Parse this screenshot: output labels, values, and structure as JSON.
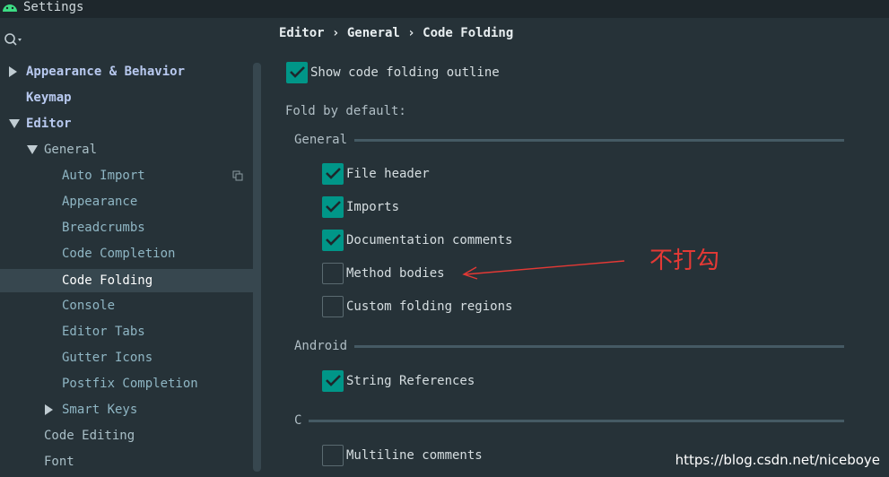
{
  "window": {
    "title": "Settings"
  },
  "sidebar": {
    "items": [
      {
        "label": "Appearance & Behavior",
        "arrow": "right"
      },
      {
        "label": "Keymap"
      },
      {
        "label": "Editor",
        "arrow": "down"
      },
      {
        "label": "General",
        "arrow": "down"
      },
      {
        "label": "Auto Import"
      },
      {
        "label": "Appearance"
      },
      {
        "label": "Breadcrumbs"
      },
      {
        "label": "Code Completion"
      },
      {
        "label": "Code Folding",
        "selected": true
      },
      {
        "label": "Console"
      },
      {
        "label": "Editor Tabs"
      },
      {
        "label": "Gutter Icons"
      },
      {
        "label": "Postfix Completion"
      },
      {
        "label": "Smart Keys",
        "arrow": "right"
      },
      {
        "label": "Code Editing"
      },
      {
        "label": "Font"
      }
    ]
  },
  "main": {
    "breadcrumb": "Editor › General › Code Folding",
    "show_outline": {
      "label": "Show code folding outline",
      "checked": true
    },
    "fold_by_default": "Fold by default:",
    "groups": [
      {
        "title": "General",
        "options": [
          {
            "label": "File header",
            "checked": true
          },
          {
            "label": "Imports",
            "checked": true
          },
          {
            "label": "Documentation comments",
            "checked": true
          },
          {
            "label": "Method bodies",
            "checked": false
          },
          {
            "label": "Custom folding regions",
            "checked": false
          }
        ]
      },
      {
        "title": "Android",
        "options": [
          {
            "label": "String References",
            "checked": true
          }
        ]
      },
      {
        "title": "C",
        "options": [
          {
            "label": "Multiline comments",
            "checked": false
          }
        ]
      }
    ]
  },
  "annotation": {
    "text": "不打勾",
    "color": "#e53935"
  },
  "watermark": "https://blog.csdn.net/niceboye",
  "colors": {
    "accent": "#009688",
    "background": "#263238",
    "selection": "#37474f"
  }
}
